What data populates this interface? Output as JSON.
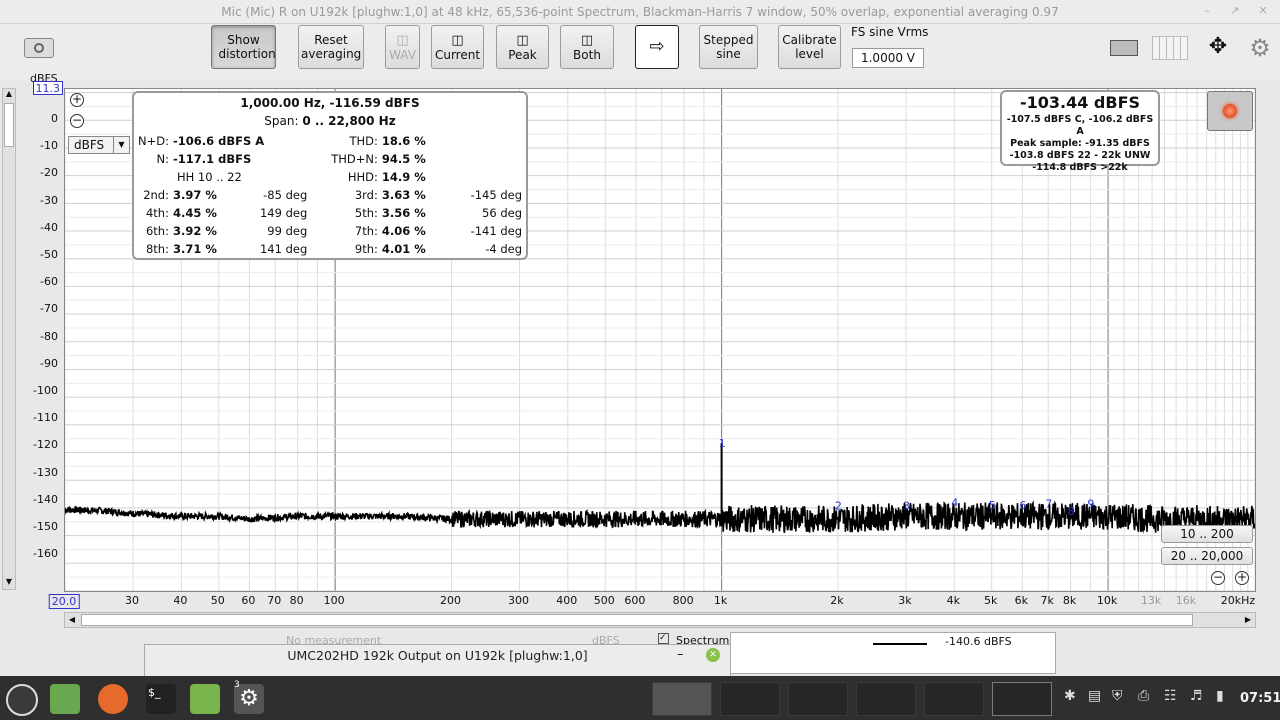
{
  "window": {
    "title": "Mic (Mic) R on U192k [plughw:1,0] at 48 kHz, 65,536-point Spectrum, Blackman-Harris 7 window, 50% overlap, exponential averaging 0.97"
  },
  "toolbar": {
    "show_distortion": "Show distortion",
    "reset_averaging": "Reset averaging",
    "wav": "WAV",
    "current": "Current",
    "peak": "Peak",
    "both": "Both",
    "stepped_sine": "Stepped sine",
    "calibrate_level": "Calibrate level",
    "fs_label": "FS sine Vrms",
    "fs_value": "1.0000 V"
  },
  "plot": {
    "y_unit": "dBFS",
    "y_top_value": "11.3",
    "y_unit_select": "dBFS",
    "y_ticks": [
      "0",
      "-10",
      "-20",
      "-30",
      "-40",
      "-50",
      "-60",
      "-70",
      "-80",
      "-90",
      "-100",
      "-110",
      "-120",
      "-130",
      "-140",
      "-150",
      "-160"
    ],
    "x_ticks": [
      "20.0",
      "30",
      "40",
      "50",
      "60",
      "70",
      "80",
      "100",
      "200",
      "300",
      "400",
      "500",
      "600",
      "800",
      "1k",
      "2k",
      "3k",
      "4k",
      "5k",
      "6k",
      "7k",
      "8k",
      "10k",
      "13k",
      "16k",
      "20kHz"
    ],
    "harmonic_markers": [
      "1",
      "2",
      "3",
      "4",
      "5",
      "6",
      "7",
      "8",
      "9"
    ],
    "range_btn_1": "10 .. 200",
    "range_btn_2": "20 .. 20,000"
  },
  "distortion": {
    "header": "1,000.00 Hz, -116.59 dBFS",
    "span_label": "Span:",
    "span_value": "0 .. 22,800 Hz",
    "nd_label": "N+D:",
    "nd_value": "-106.6 dBFS A",
    "thd_label": "THD:",
    "thd_value": "18.6 %",
    "n_label": "N:",
    "n_value": "-117.1 dBFS",
    "thdn_label": "THD+N:",
    "thdn_value": "94.5 %",
    "hh_label": "HH 10 .. 22",
    "hhd_label": "HHD:",
    "hhd_value": "14.9 %",
    "harmonics": [
      {
        "l": "2nd:",
        "v": "3.97 %",
        "d": "-85 deg",
        "l2": "3rd:",
        "v2": "3.63 %",
        "d2": "-145 deg"
      },
      {
        "l": "4th:",
        "v": "4.45 %",
        "d": "149 deg",
        "l2": "5th:",
        "v2": "3.56 %",
        "d2": "56 deg"
      },
      {
        "l": "6th:",
        "v": "3.92 %",
        "d": "99 deg",
        "l2": "7th:",
        "v2": "4.06 %",
        "d2": "-141 deg"
      },
      {
        "l": "8th:",
        "v": "3.71 %",
        "d": "141 deg",
        "l2": "9th:",
        "v2": "4.01 %",
        "d2": "-4 deg"
      }
    ]
  },
  "level_panel": {
    "main": "-103.44 dBFS",
    "line1": "-107.5 dBFS C, -106.2 dBFS A",
    "line2": "Peak sample: -91.35 dBFS",
    "line3": "-103.8 dBFS 22 - 22k UNW",
    "line4": "-114.8 dBFS >22k"
  },
  "bottom": {
    "no_measurement": "No measurement",
    "dbfs": "dBFS",
    "spectrum": "Spectrum",
    "legend_value": "-140.6 dBFS",
    "float_title": "UMC202HD 192k Output on U192k [plughw:1,0]"
  },
  "taskbar": {
    "clock": "07:51",
    "badge": "3"
  },
  "chart_data": {
    "type": "line",
    "title": "",
    "xlabel": "",
    "ylabel": "dBFS",
    "x_scale": "log",
    "xlim": [
      20,
      24000
    ],
    "ylim": [
      -170,
      11.3
    ],
    "grid": true,
    "series": [
      {
        "x": [
          20,
          25,
          30,
          40,
          50,
          60,
          80,
          100,
          150,
          200,
          300,
          400,
          500,
          600,
          800,
          950,
          1000,
          1050,
          1200,
          1500,
          2000,
          3000,
          4000,
          5000,
          6000,
          7000,
          8000,
          9000,
          10000,
          13000,
          16000,
          20000,
          24000
        ],
        "values": [
          -140.6,
          -141,
          -142,
          -143,
          -143,
          -144,
          -143,
          -143,
          -143,
          -144,
          -144,
          -144,
          -144,
          -144,
          -144,
          -144,
          -116.6,
          -144,
          -144,
          -144,
          -144,
          -143,
          -143,
          -143,
          -143,
          -143,
          -143,
          -143,
          -143,
          -144,
          -144,
          -144,
          -144
        ]
      }
    ],
    "markers": [
      {
        "label": "1",
        "x": 1000
      },
      {
        "label": "2",
        "x": 2000
      },
      {
        "label": "3",
        "x": 3000
      },
      {
        "label": "4",
        "x": 4000
      },
      {
        "label": "5",
        "x": 5000
      },
      {
        "label": "6",
        "x": 6000
      },
      {
        "label": "7",
        "x": 7000
      },
      {
        "label": "8",
        "x": 8000
      },
      {
        "label": "9",
        "x": 9000
      }
    ]
  }
}
